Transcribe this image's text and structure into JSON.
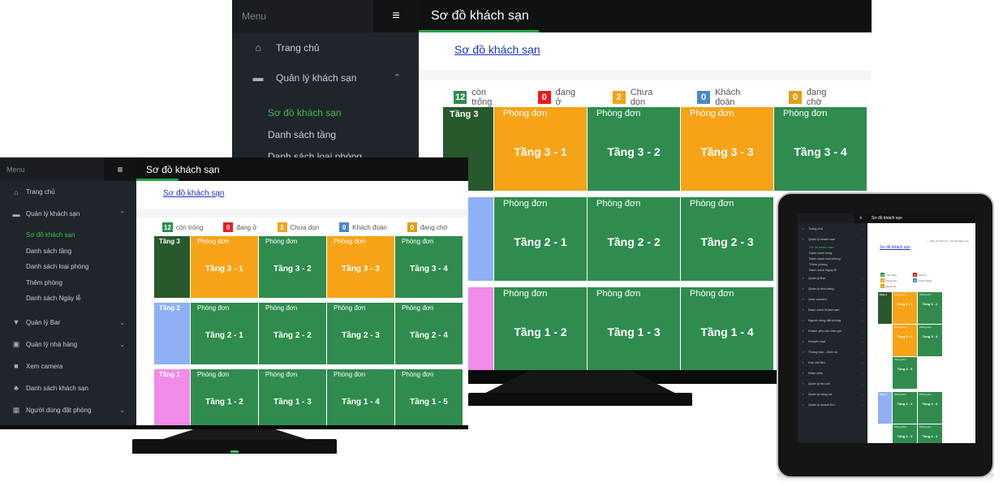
{
  "app": {
    "menu_label": "Menu",
    "burger_icon": "≡",
    "page_title": "Sơ đồ khách sạn",
    "breadcrumb_link": "Sơ đồ khách sạn",
    "tablet_breadcrumb": "⌂ > Bài cho thường > Sơ đồ khách sạn"
  },
  "sidebar_full": {
    "items": [
      {
        "icon": "home-icon",
        "glyph": "⌂",
        "label": "Trang chủ",
        "chevron": ""
      },
      {
        "icon": "bed-icon",
        "glyph": "▬",
        "label": "Quản lý khách sạn",
        "chevron": "⌃"
      }
    ],
    "subitems": [
      "Sơ đồ khách sạn",
      "Danh sách tầng",
      "Danh sách loại phòng",
      "Thêm phòng",
      "Danh sách Ngày lễ"
    ],
    "lower_items": [
      {
        "icon": "glass-icon",
        "glyph": "▼",
        "label": "Quản lý Bar",
        "chevron": "⌄"
      },
      {
        "icon": "dish-icon",
        "glyph": "▣",
        "label": "Quản lý nhà hàng",
        "chevron": "⌄"
      },
      {
        "icon": "camera-icon",
        "glyph": "■",
        "label": "Xem camera",
        "chevron": ""
      },
      {
        "icon": "sitemap-icon",
        "glyph": "♣",
        "label": "Danh sách khách sạn",
        "chevron": ""
      },
      {
        "icon": "calendar-icon",
        "glyph": "▦",
        "label": "Người dùng đặt phòng",
        "chevron": "⌄"
      }
    ]
  },
  "tablet_sidebar": {
    "items_top": [
      {
        "label": "Trang chủ"
      },
      {
        "label": "Quản lý khách sạn"
      }
    ],
    "subitems": [
      "Sơ đồ khách sạn",
      "Danh sách tầng",
      "Danh sách loại phòng",
      "Thêm phòng",
      "Danh sách Ngày lễ"
    ],
    "items_bottom": [
      {
        "label": "Quản lý Bar"
      },
      {
        "label": "Quản lý nhà hàng"
      },
      {
        "label": "Xem camera"
      },
      {
        "label": "Danh sách khách sạn"
      },
      {
        "label": "Người dùng đặt phòng"
      },
      {
        "label": "Khách yêu cầu báo giá"
      },
      {
        "label": "Khuyến mại"
      },
      {
        "label": "Thông báo - Dịch vụ"
      },
      {
        "label": "Kho vật liệu"
      },
      {
        "label": "Nhân viên"
      },
      {
        "label": "Quản lý thu chi"
      },
      {
        "label": "Quản lý công nợ"
      },
      {
        "label": "Quản lý doanh thu"
      }
    ]
  },
  "legend": [
    {
      "count": "12",
      "label": "còn trống",
      "color": "#2f8c4e"
    },
    {
      "count": "0",
      "label": "đang ở",
      "color": "#ee1b1b"
    },
    {
      "count": "2",
      "label": "Chưa dọn",
      "color": "#f4a318"
    },
    {
      "count": "0",
      "label": "Khách đoàn",
      "color": "#4d87c7"
    },
    {
      "count": "0",
      "label": "đang chờ",
      "color": "#e0a112"
    }
  ],
  "room_type": "Phòng đơn",
  "floors_front": [
    {
      "floor": "Tầng 3",
      "floor_color": "dgreen",
      "rooms": [
        {
          "name": "Tầng 3 - 1",
          "color": "orange"
        },
        {
          "name": "Tầng 3 - 2",
          "color": "green"
        },
        {
          "name": "Tầng 3 - 3",
          "color": "orange"
        },
        {
          "name": "Tầng 3 - 4",
          "color": "green"
        }
      ]
    },
    {
      "floor": "Tầng 2",
      "floor_color": "blue",
      "rooms": [
        {
          "name": "Tầng 2 - 1",
          "color": "green"
        },
        {
          "name": "Tầng 2 - 2",
          "color": "green"
        },
        {
          "name": "Tầng 2 - 3",
          "color": "green"
        },
        {
          "name": "Tầng 2 - 4",
          "color": "green"
        }
      ]
    },
    {
      "floor": "Tầng 1",
      "floor_color": "pink",
      "rooms": [
        {
          "name": "Tầng 1 - 2",
          "color": "green"
        },
        {
          "name": "Tầng 1 - 3",
          "color": "green"
        },
        {
          "name": "Tầng 1 - 4",
          "color": "green"
        },
        {
          "name": "Tầng 1 - 5",
          "color": "green"
        }
      ]
    }
  ],
  "floors_back": [
    {
      "floor": "Tầng 3",
      "floor_color": "dgreen",
      "rooms": [
        {
          "name": "Tầng 3 - 1",
          "color": "orange"
        },
        {
          "name": "Tầng 3 - 2",
          "color": "green"
        },
        {
          "name": "Tầng 3 - 3",
          "color": "orange"
        },
        {
          "name": "Tầng 3 - 4",
          "color": "green"
        }
      ]
    },
    {
      "floor": "2",
      "floor_color": "blue",
      "rooms": [
        {
          "name": "Tầng 2 - 1",
          "color": "green"
        },
        {
          "name": "Tầng 2 - 2",
          "color": "green"
        },
        {
          "name": "Tầng 2 - 3",
          "color": "green"
        }
      ]
    },
    {
      "floor": "1",
      "floor_color": "pink",
      "rooms": [
        {
          "name": "Tầng 1 - 2",
          "color": "green"
        },
        {
          "name": "Tầng 1 - 3",
          "color": "green"
        },
        {
          "name": "Tầng 1 - 4",
          "color": "green"
        }
      ]
    }
  ],
  "floors_tablet": [
    {
      "floor": "Tầng 3",
      "floor_color": "dgreen",
      "rows": [
        [
          {
            "name": "Tầng 3 - 1",
            "color": "orange"
          },
          {
            "name": "Tầng 3 - 2",
            "color": "green"
          }
        ],
        [
          {
            "name": "Tầng 3 - 3",
            "color": "orange"
          },
          {
            "name": "Tầng 3 - 4",
            "color": "green"
          }
        ],
        [
          {
            "name": "Tầng 3 - 5",
            "color": "green"
          }
        ]
      ]
    },
    {
      "floor": "Tầng 2",
      "floor_color": "blue",
      "rows": [
        [
          {
            "name": "Tầng 2 - 1",
            "color": "green"
          },
          {
            "name": "Tầng 2 - 2",
            "color": "green"
          }
        ],
        [
          {
            "name": "Tầng 2 - 3",
            "color": "green"
          },
          {
            "name": "Tầng 2 - 4",
            "color": "green"
          }
        ]
      ]
    }
  ]
}
